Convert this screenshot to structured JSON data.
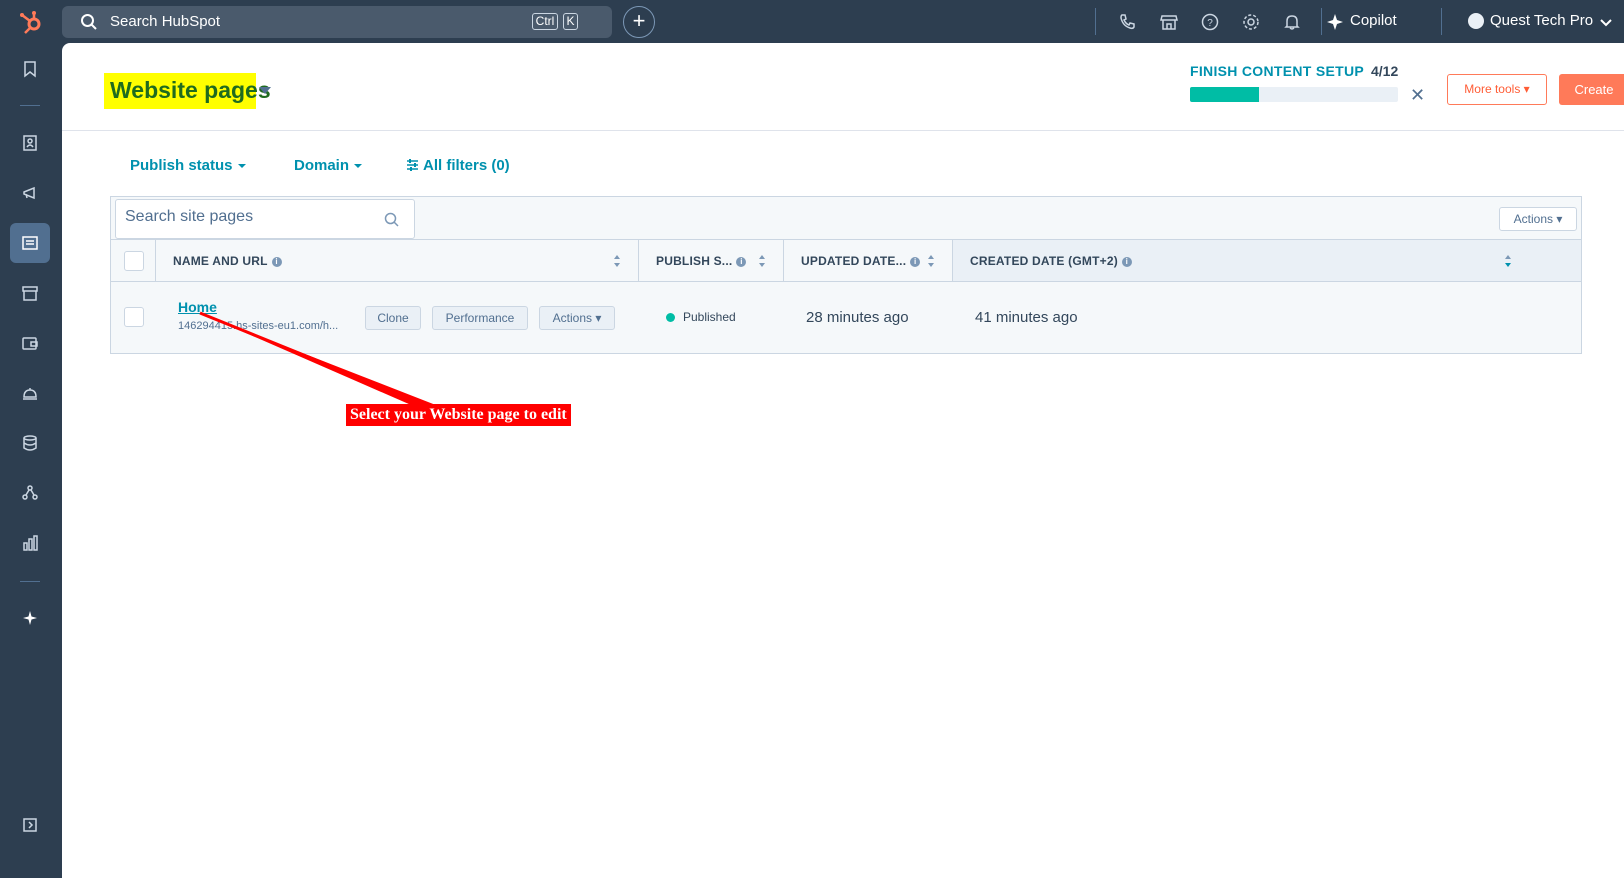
{
  "topbar": {
    "search_placeholder": "Search HubSpot",
    "kbd_ctrl": "Ctrl",
    "kbd_k": "K",
    "copilot_label": "Copilot",
    "user_name": "Quest Tech Pro"
  },
  "header": {
    "title": "Website pages",
    "setup_label": "FINISH CONTENT SETUP",
    "setup_count": "4/12",
    "setup_progress": 0.33,
    "more_tools_label": "More tools ▾",
    "create_label": "Create"
  },
  "filters": {
    "publish_status": "Publish status",
    "domain": "Domain",
    "all_filters": "All filters (0)"
  },
  "table": {
    "search_placeholder": "Search site pages",
    "actions_label": "Actions ▾",
    "columns": {
      "name": "NAME AND URL",
      "publish": "PUBLISH S...",
      "updated": "UPDATED DATE...",
      "created": "CREATED DATE (GMT+2)"
    },
    "rows": [
      {
        "name": "Home",
        "url": "146294415.hs-sites-eu1.com/h...",
        "clone_label": "Clone",
        "performance_label": "Performance",
        "actions_label": "Actions ▾",
        "status": "Published",
        "updated": "28 minutes ago",
        "created": "41 minutes ago"
      }
    ]
  },
  "annotation": {
    "text": "Select your Website page to edit"
  },
  "colors": {
    "nav": "#2d3e50",
    "accent": "#0091ae",
    "brand": "#ff7a59",
    "success": "#00bda5",
    "highlight": "#ffff00",
    "annotation": "#ff0000"
  }
}
